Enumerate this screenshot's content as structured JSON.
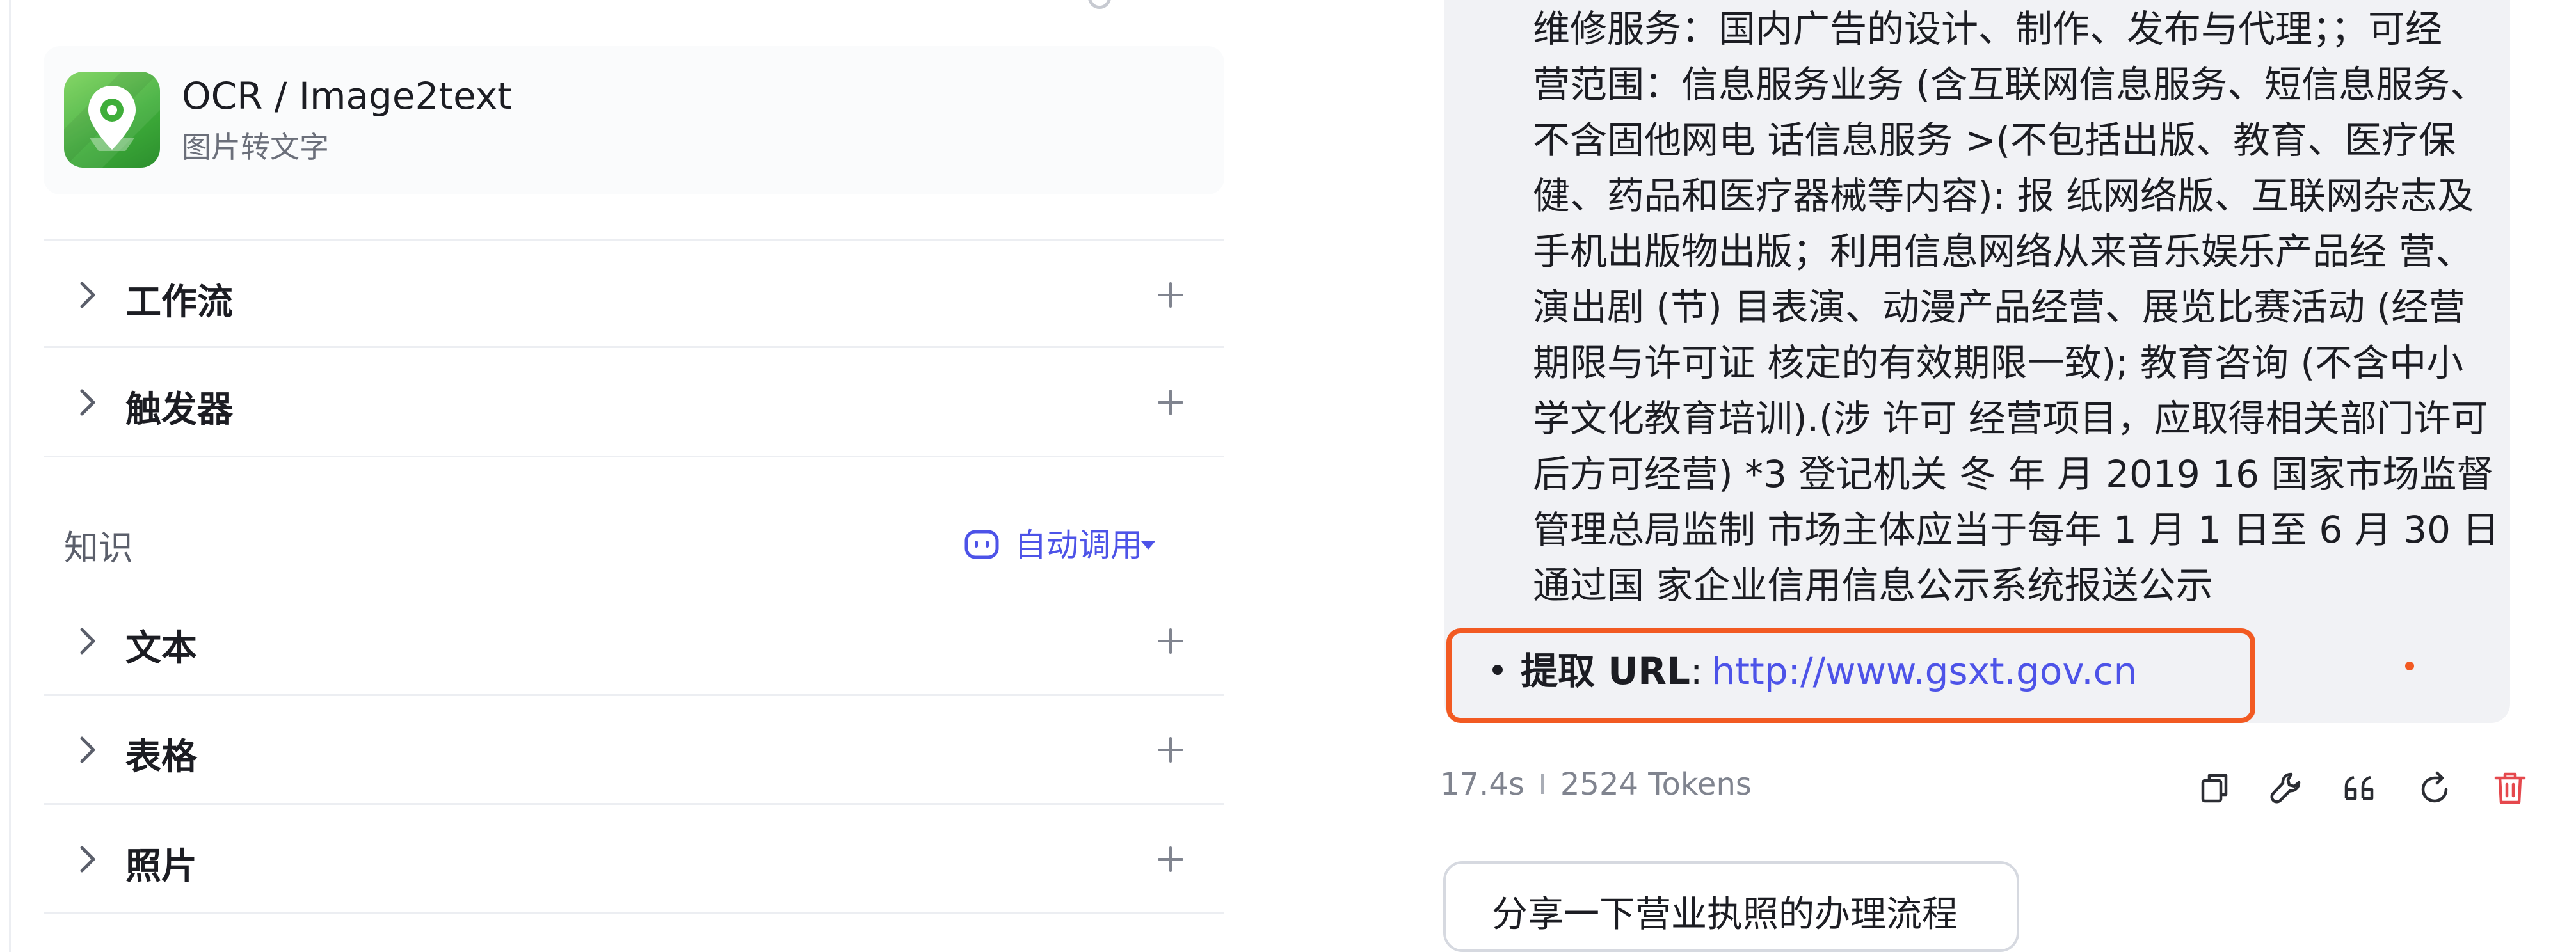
{
  "plugin": {
    "title": "OCR / Image2text",
    "subtitle": "图片转文字",
    "logo_icon": "map-pin-logo-icon"
  },
  "sections_top": [
    {
      "label": "工作流"
    },
    {
      "label": "触发器"
    }
  ],
  "knowledge": {
    "heading": "知识",
    "auto_call_label": "自动调用",
    "auto_call_icon": "robot-face-icon",
    "items": [
      {
        "label": "文本"
      },
      {
        "label": "表格"
      },
      {
        "label": "照片"
      }
    ]
  },
  "message": {
    "lines": [
      "维修服务：国内广告的设计、制作、发布与代理；；可经",
      "营范围：信息服务业务 (含互联网信息服务、短信息服务、",
      "不含固他网电 话信息服务 >(不包括出版、教育、医疗保",
      "健、药品和医疗器械等内容): 报 纸网络版、互联网杂志及",
      "手机出版物出版；利用信息网络从来音乐娱乐产品经 营、",
      "演出剧 (节) 目表演、动漫产品经营、展览比赛活动 (经营",
      "期限与许可证 核定的有效期限一致); 教育咨询 (不含中小",
      "学文化教育培训).(涉 许可 经营项目，应取得相关部门许可",
      "后方可经营) *3 登记机关 冬 年 月 2019 16 国家市场监督",
      "管理总局监制 市场主体应当于每年 1 月 1 日至 6 月 30 日",
      "通过国 家企业信用信息公示系统报送公示"
    ],
    "url_item": {
      "label": "提取 URL",
      "colon": ":",
      "link": "http://www.gsxt.gov.cn"
    }
  },
  "meta": {
    "time": "17.4s",
    "tokens": "2524 Tokens"
  },
  "actions": [
    {
      "name": "copy-icon"
    },
    {
      "name": "wrench-icon"
    },
    {
      "name": "quote-icon"
    },
    {
      "name": "refresh-icon"
    },
    {
      "name": "delete-icon"
    }
  ],
  "suggestion": {
    "text": "分享一下营业执照的办理流程"
  },
  "colors": {
    "accent": "#4d53e8",
    "highlight_border": "#f25a22",
    "delete": "#e5484d",
    "bubble_bg": "#f1f2f5"
  }
}
